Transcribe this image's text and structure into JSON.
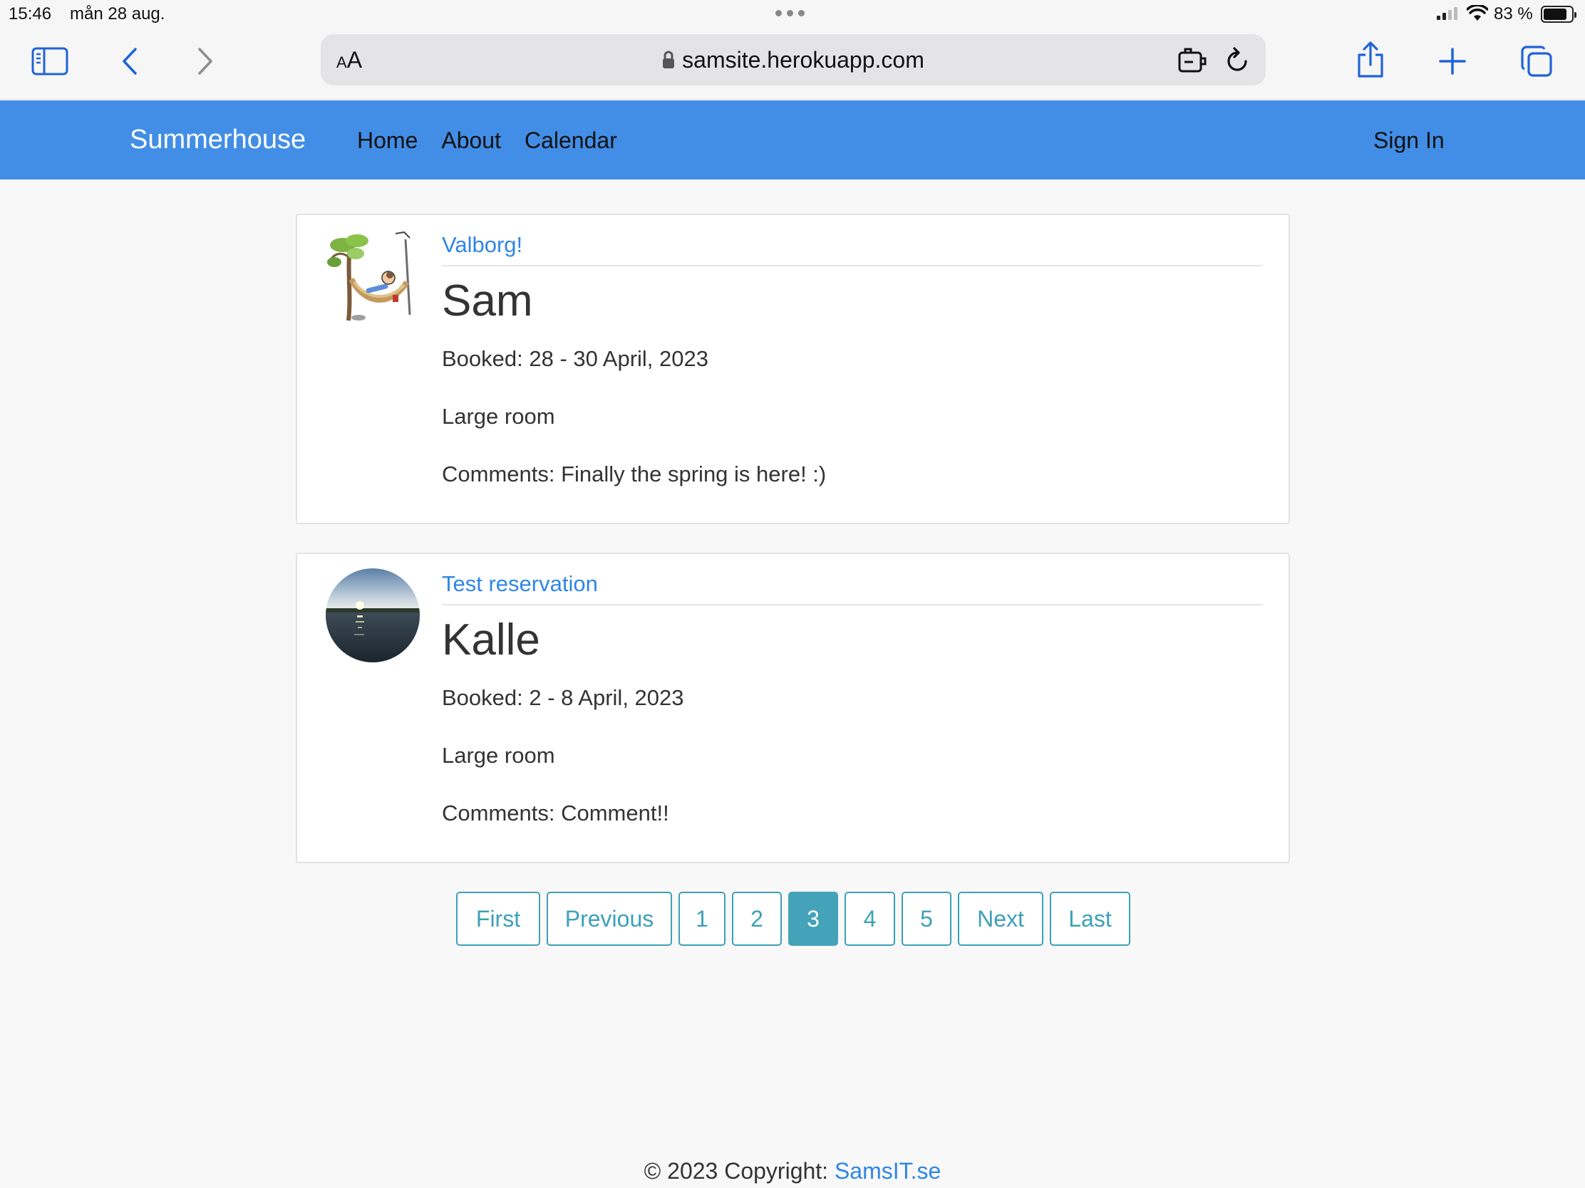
{
  "status_bar": {
    "time": "15:46",
    "date": "mån 28 aug.",
    "battery": "83 %"
  },
  "browser": {
    "text_size_label": "AA",
    "url": "samsite.herokuapp.com",
    "icons": [
      "sidebar-icon",
      "back-icon",
      "forward-icon",
      "lock-icon",
      "extension-icon",
      "reload-icon",
      "share-icon",
      "new-tab-icon",
      "tabs-icon"
    ]
  },
  "navbar": {
    "brand": "Summerhouse",
    "links": [
      "Home",
      "About",
      "Calendar"
    ],
    "sign_in": "Sign In",
    "color": "#428ee6"
  },
  "reservations": [
    {
      "title": "Valborg!",
      "name": "Sam",
      "booked": "Booked: 28 - 30 April, 2023",
      "room": "Large room",
      "comments": "Comments: Finally the spring is here! :)",
      "avatar": "hammock-illustration"
    },
    {
      "title": "Test reservation",
      "name": "Kalle",
      "booked": "Booked: 2 - 8 April, 2023",
      "room": "Large room",
      "comments": "Comments: Comment!!",
      "avatar": "sunset-lake-photo"
    }
  ],
  "pagination": {
    "first": "First",
    "previous": "Previous",
    "pages": [
      "1",
      "2",
      "3",
      "4",
      "5"
    ],
    "current": "3",
    "next": "Next",
    "last": "Last",
    "accent": "#3da0b8"
  },
  "footer": {
    "copyright": "© 2023 Copyright: ",
    "link": "SamsIT.se"
  }
}
